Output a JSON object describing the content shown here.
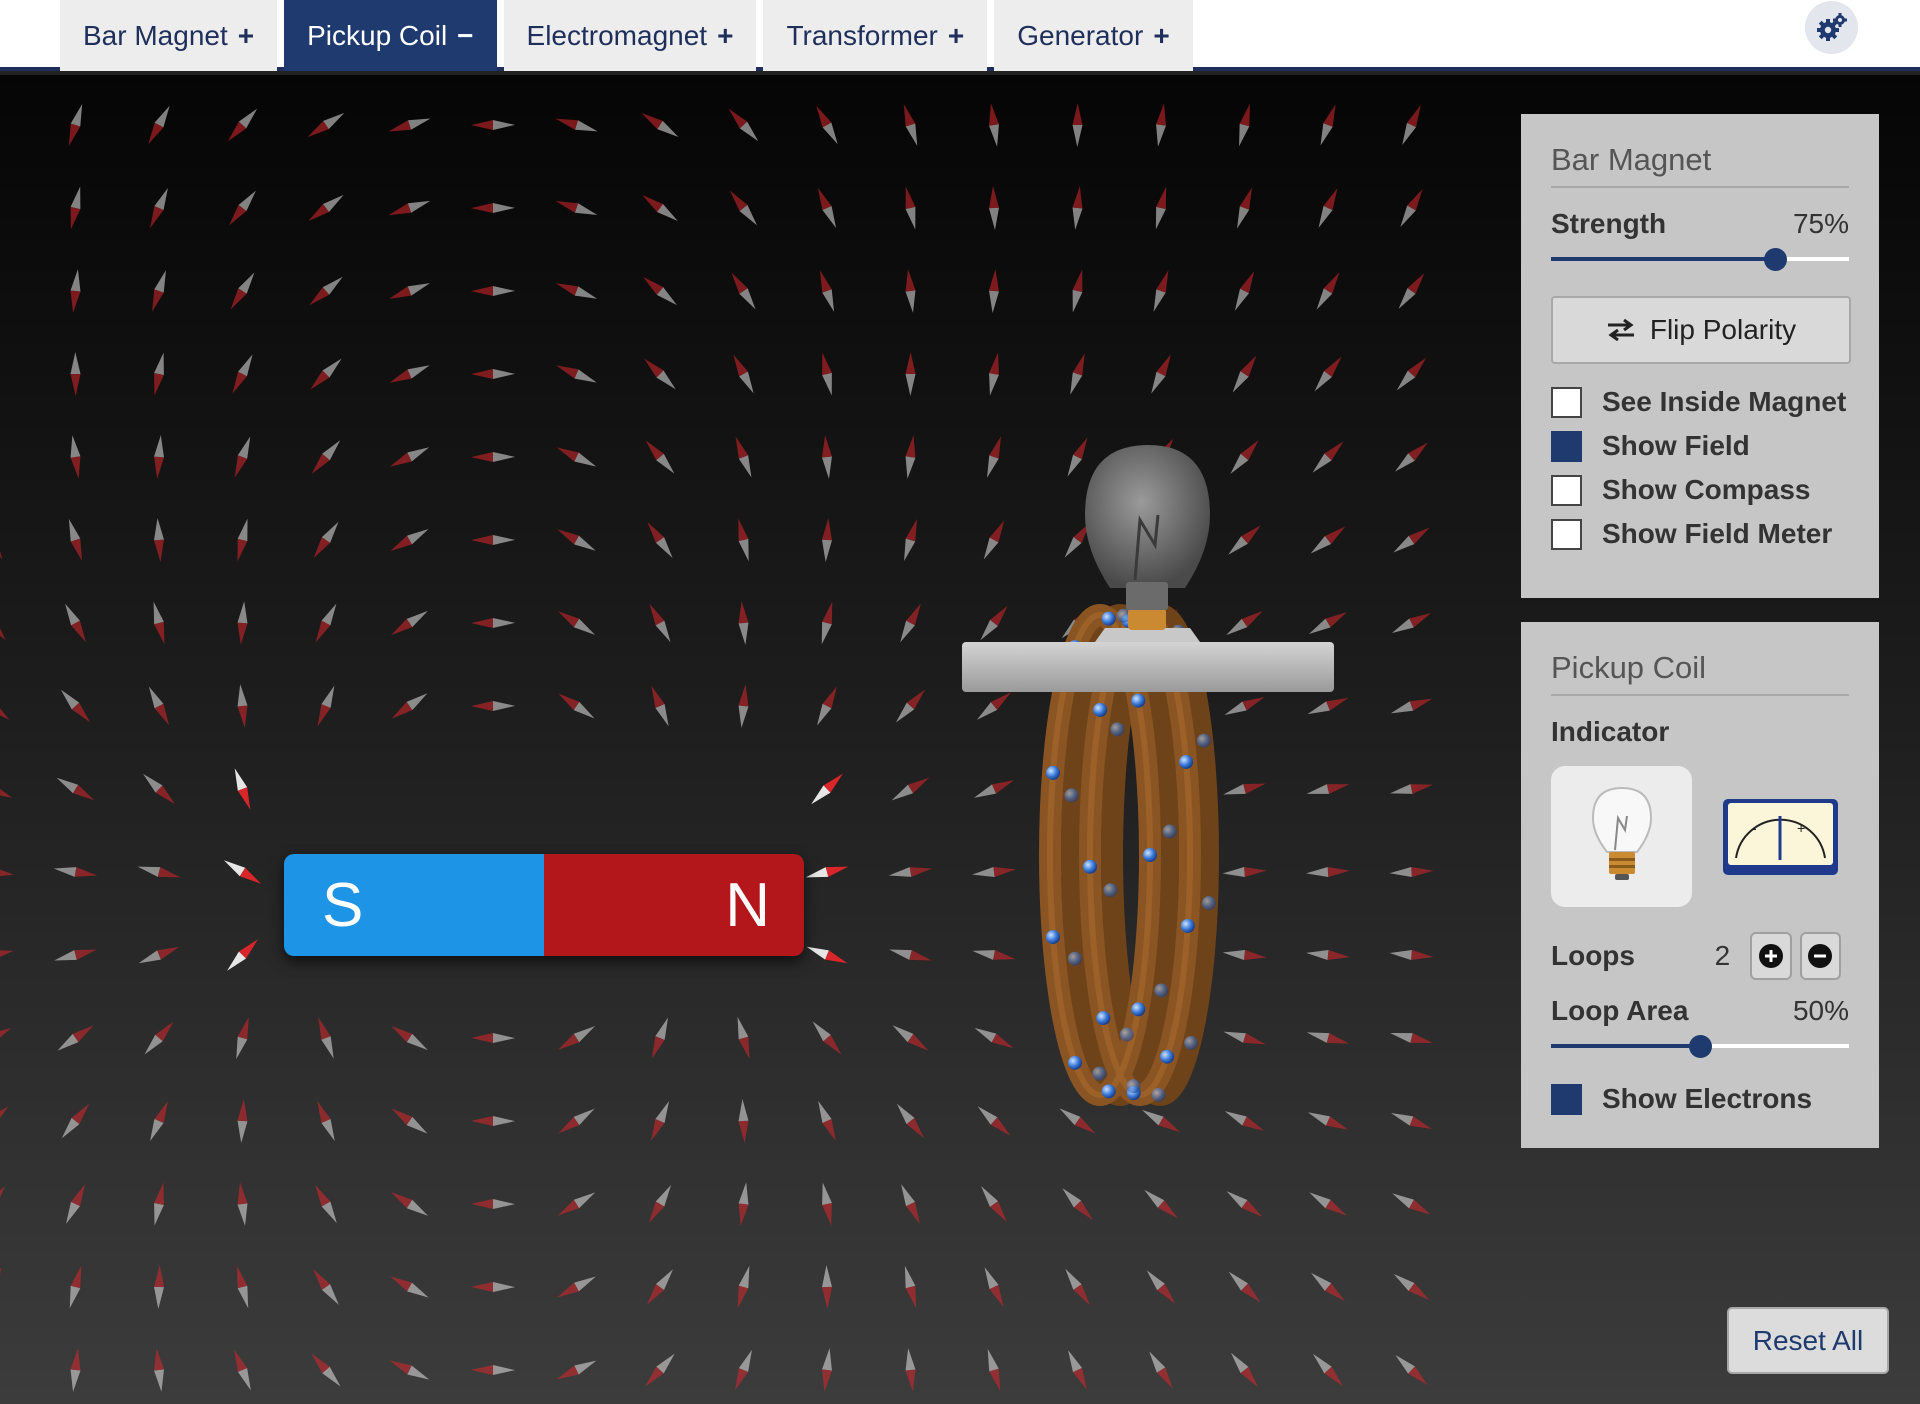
{
  "tabs": [
    {
      "label": "Bar Magnet",
      "sign": "+"
    },
    {
      "label": "Pickup Coil",
      "sign": "−"
    },
    {
      "label": "Electromagnet",
      "sign": "+"
    },
    {
      "label": "Transformer",
      "sign": "+"
    },
    {
      "label": "Generator",
      "sign": "+"
    }
  ],
  "active_tab": "Pickup Coil",
  "settings_icon": "gears-icon",
  "magnet": {
    "south_label": "S",
    "north_label": "N",
    "south_color": "#1e94e6",
    "north_color": "#b3161b"
  },
  "bar_magnet_panel": {
    "title": "Bar Magnet",
    "strength_label": "Strength",
    "strength_value": "75%",
    "strength_fraction": 0.75,
    "flip_label": "Flip Polarity",
    "checkboxes": [
      {
        "label": "See Inside Magnet",
        "checked": false
      },
      {
        "label": "Show Field",
        "checked": true
      },
      {
        "label": "Show Compass",
        "checked": false
      },
      {
        "label": "Show Field Meter",
        "checked": false
      }
    ]
  },
  "pickup_coil_panel": {
    "title": "Pickup Coil",
    "indicator_label": "Indicator",
    "indicator_selected": "lightbulb",
    "loops_label": "Loops",
    "loops_value": "2",
    "loop_area_label": "Loop Area",
    "loop_area_value": "50%",
    "loop_area_fraction": 0.5,
    "show_electrons_label": "Show Electrons",
    "show_electrons_checked": true
  },
  "reset_label": "Reset All",
  "colors": {
    "accent": "#1f3a6e",
    "panel": "#c6c6c6",
    "coil": "#8a5522",
    "electron": "#3a7ad9"
  }
}
